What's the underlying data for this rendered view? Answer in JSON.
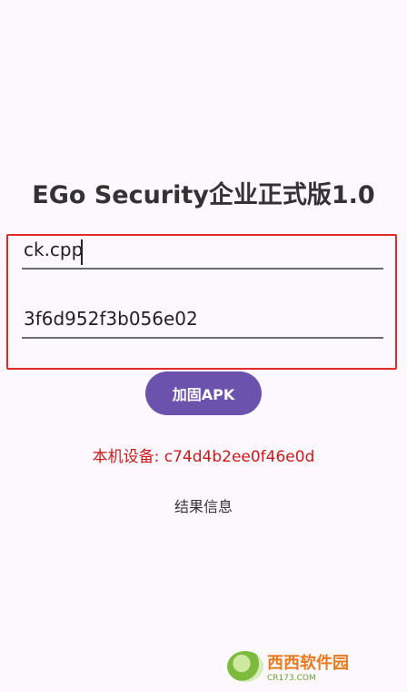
{
  "app": {
    "title": "EGo Security企业正式版1.0"
  },
  "form": {
    "field1_value": "ck.cpp",
    "field2_value": "3f6d952f3b056e02"
  },
  "actions": {
    "harden_label": "加固APK"
  },
  "status": {
    "device_text": "本机设备: c74d4b2ee0f46e0d",
    "result_text": "结果信息"
  },
  "watermark": {
    "main": "西西软件园",
    "sub": "CR173.COM"
  },
  "colors": {
    "accent": "#6b52ad",
    "highlight": "#e02a2a",
    "device_text": "#cc1a1a",
    "background": "#fdf8fd"
  }
}
